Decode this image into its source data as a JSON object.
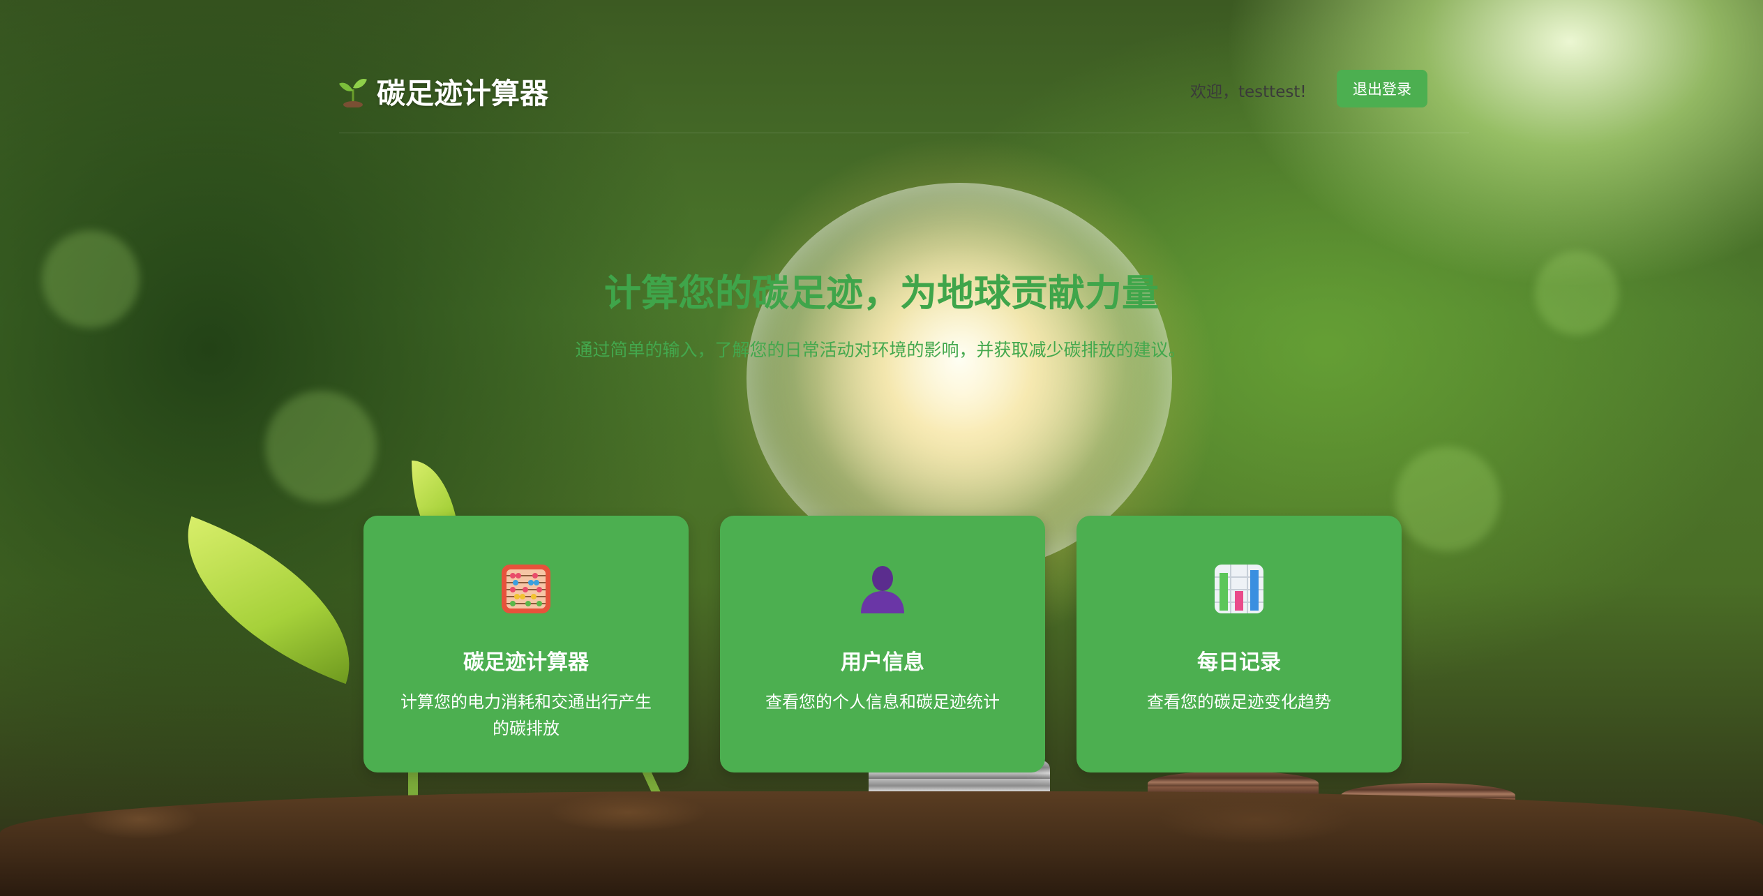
{
  "header": {
    "app_title": "碳足迹计算器",
    "logo_icon": "seedling-icon",
    "welcome_text": "欢迎，testtest!",
    "logout_label": "退出登录"
  },
  "hero": {
    "title": "计算您的碳足迹，为地球贡献力量",
    "subtitle": "通过简单的输入，了解您的日常活动对环境的影响，并获取减少碳排放的建议。"
  },
  "cards": [
    {
      "icon": "abacus-icon",
      "title": "碳足迹计算器",
      "description": "计算您的电力消耗和交通出行产生的碳排放"
    },
    {
      "icon": "user-silhouette-icon",
      "title": "用户信息",
      "description": "查看您的个人信息和碳足迹统计"
    },
    {
      "icon": "bar-chart-icon",
      "title": "每日记录",
      "description": "查看您的碳足迹变化趋势"
    }
  ],
  "colors": {
    "accent_green": "#4caf50",
    "title_green": "#3fa54a",
    "white": "#ffffff"
  }
}
